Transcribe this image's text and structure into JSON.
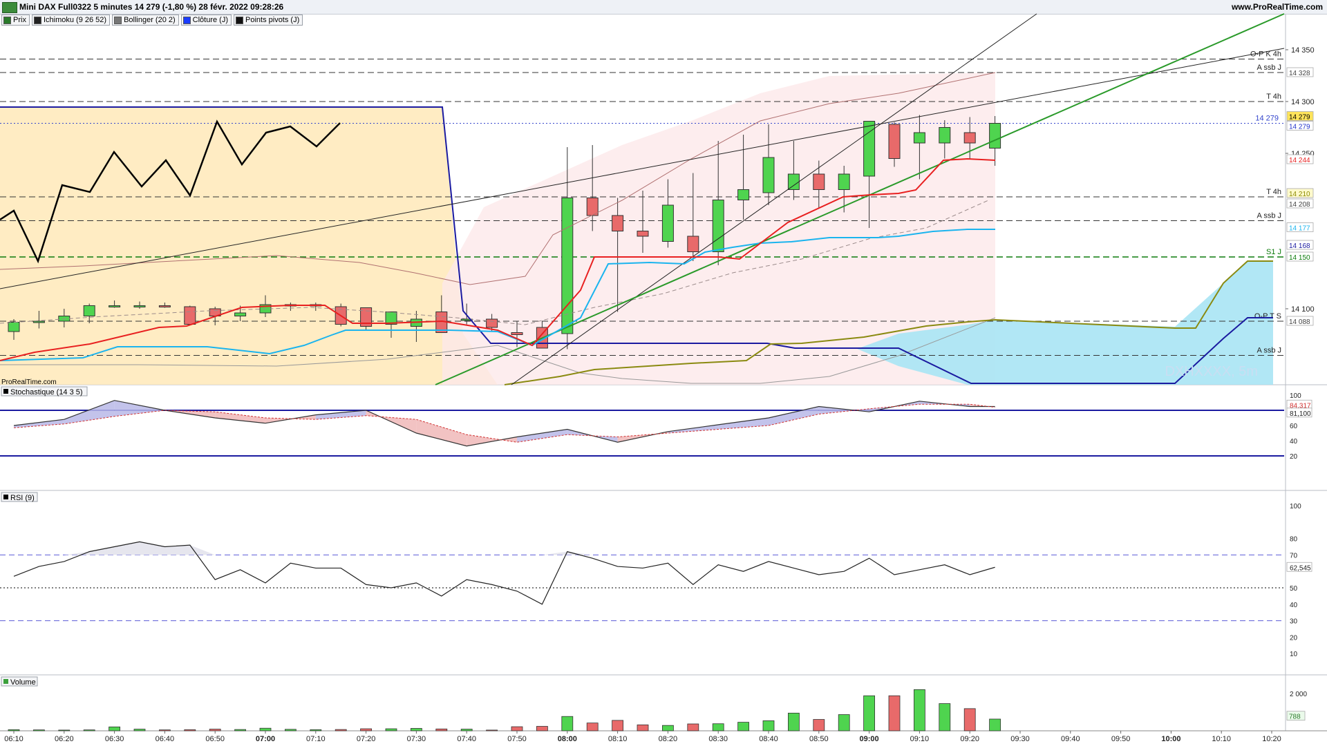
{
  "window": {
    "title": "Mini DAX Full0322 5 minutes 14 279 (-1,80 %) 28 févr. 2022 09:28:26",
    "site": "www.ProRealTime.com",
    "watermark_site": "ProRealTime.com",
    "watermark": "DXHXXXX, 5m"
  },
  "colors": {
    "bull": "#4fd44f",
    "bear": "#e86a6a",
    "tenkan": "#e82020",
    "kijun": "#1ab4ee",
    "chikou": "#000000",
    "cloud_bull": "#ffe9b8",
    "cloud_bear": "#a8e4f4",
    "bollinger": "#b07070",
    "blue_line": "#1a1aa0"
  },
  "legend": [
    {
      "label": "Prix",
      "swatch": "#2a7a2a"
    },
    {
      "label": "Ichimoku (9 26 52)",
      "swatch": "#222222"
    },
    {
      "label": "Bollinger (20 2)",
      "swatch": "#777777"
    },
    {
      "label": "Clôture (J)",
      "swatch": "#1a3cff"
    },
    {
      "label": "Points pivots (J)",
      "swatch": "#111111"
    }
  ],
  "chart_data": [
    {
      "type": "candlestick",
      "name": "Mini DAX Full0322 5 minutes",
      "x": [
        "06:10",
        "06:15",
        "06:20",
        "06:25",
        "06:30",
        "06:35",
        "06:40",
        "06:45",
        "06:50",
        "06:55",
        "07:00",
        "07:05",
        "07:10",
        "07:15",
        "07:20",
        "07:25",
        "07:30",
        "07:35",
        "07:40",
        "07:45",
        "07:50",
        "07:55",
        "08:00",
        "08:05",
        "08:10",
        "08:15",
        "08:20",
        "08:25",
        "08:30",
        "08:35",
        "08:40",
        "08:45",
        "08:50",
        "08:55",
        "09:00",
        "09:05",
        "09:10",
        "09:15",
        "09:20",
        "09:25"
      ],
      "open": [
        14078,
        14087,
        14088,
        14093,
        14103,
        14103,
        14103,
        14102,
        14100,
        14093,
        14096,
        14104,
        14104,
        14102,
        14101,
        14085,
        14083,
        14097,
        14090,
        14090,
        14077,
        14082,
        14076,
        14207,
        14190,
        14175,
        14165,
        14170,
        14155,
        14205,
        14212,
        14215,
        14230,
        14215,
        14228,
        14278,
        14260,
        14260,
        14270,
        14255
      ],
      "high": [
        14090,
        14098,
        14100,
        14105,
        14108,
        14107,
        14106,
        14103,
        14102,
        14103,
        14113,
        14106,
        14106,
        14105,
        14101,
        14096,
        14098,
        14113,
        14105,
        14095,
        14088,
        14088,
        14256,
        14258,
        14207,
        14214,
        14225,
        14231,
        14262,
        14268,
        14278,
        14262,
        14243,
        14238,
        14281,
        14280,
        14287,
        14282,
        14285,
        14286
      ],
      "low": [
        14070,
        14081,
        14082,
        14086,
        14101,
        14100,
        14101,
        14084,
        14084,
        14088,
        14092,
        14098,
        14098,
        14083,
        14079,
        14072,
        14068,
        14080,
        14085,
        14078,
        14063,
        14062,
        14061,
        14175,
        14097,
        14154,
        14159,
        14146,
        14142,
        14186,
        14200,
        14205,
        14197,
        14193,
        14178,
        14237,
        14225,
        14245,
        14245,
        14238
      ],
      "close": [
        14087,
        14088,
        14093,
        14103,
        14103,
        14103,
        14102,
        14085,
        14093,
        14096,
        14104,
        14104,
        14104,
        14085,
        14083,
        14097,
        14090,
        14077,
        14090,
        14082,
        14075,
        14062,
        14207,
        14190,
        14175,
        14170,
        14200,
        14155,
        14205,
        14215,
        14246,
        14230,
        14215,
        14230,
        14281,
        14245,
        14270,
        14275,
        14260,
        14279
      ]
    },
    {
      "type": "bar",
      "name": "Volume",
      "x": [
        "06:10",
        "06:15",
        "06:20",
        "06:25",
        "06:30",
        "06:35",
        "06:40",
        "06:45",
        "06:50",
        "06:55",
        "07:00",
        "07:05",
        "07:10",
        "07:15",
        "07:20",
        "07:25",
        "07:30",
        "07:35",
        "07:40",
        "07:45",
        "07:50",
        "07:55",
        "08:00",
        "08:05",
        "08:10",
        "08:15",
        "08:20",
        "08:25",
        "08:30",
        "08:35",
        "08:40",
        "08:45",
        "08:50",
        "08:55",
        "09:00",
        "09:05",
        "09:10",
        "09:15",
        "09:20",
        "09:25"
      ],
      "values": [
        60,
        50,
        40,
        50,
        210,
        90,
        50,
        60,
        90,
        70,
        140,
        80,
        60,
        70,
        110,
        110,
        130,
        100,
        90,
        40,
        220,
        240,
        770,
        420,
        560,
        320,
        290,
        370,
        380,
        460,
        540,
        950,
        610,
        870,
        1880,
        1880,
        2210,
        1460,
        1190,
        630
      ],
      "last_value_label": "788"
    },
    {
      "type": "line",
      "name": "Stochastique (14 3 5)",
      "x": [
        "06:10",
        "06:20",
        "06:30",
        "06:40",
        "06:50",
        "07:00",
        "07:10",
        "07:20",
        "07:30",
        "07:40",
        "07:50",
        "08:00",
        "08:10",
        "08:20",
        "08:30",
        "08:40",
        "08:50",
        "09:00",
        "09:10",
        "09:20",
        "09:25"
      ],
      "series": [
        {
          "values": [
            60,
            68,
            93,
            80,
            70,
            63,
            74,
            80,
            50,
            33,
            45,
            55,
            38,
            52,
            61,
            70,
            85,
            78,
            92,
            85,
            85
          ]
        },
        {
          "values": [
            57,
            62,
            72,
            80,
            78,
            70,
            68,
            73,
            68,
            48,
            38,
            48,
            45,
            50,
            55,
            60,
            75,
            82,
            88,
            88,
            84
          ]
        }
      ],
      "levels": [
        20,
        80
      ],
      "ticks": [
        "100",
        "84,317",
        "81,100",
        "60",
        "40",
        "20"
      ]
    },
    {
      "type": "line",
      "name": "RSI (9)",
      "x": [
        "06:10",
        "06:15",
        "06:20",
        "06:25",
        "06:30",
        "06:35",
        "06:40",
        "06:45",
        "06:50",
        "06:55",
        "07:00",
        "07:05",
        "07:10",
        "07:15",
        "07:20",
        "07:25",
        "07:30",
        "07:35",
        "07:40",
        "07:45",
        "07:50",
        "07:55",
        "08:00",
        "08:05",
        "08:10",
        "08:15",
        "08:20",
        "08:25",
        "08:30",
        "08:35",
        "08:40",
        "08:45",
        "08:50",
        "08:55",
        "09:00",
        "09:05",
        "09:10",
        "09:15",
        "09:20",
        "09:25"
      ],
      "values": [
        57,
        63,
        66,
        72,
        75,
        78,
        75,
        76,
        55,
        61,
        53,
        65,
        62,
        62,
        52,
        50,
        53,
        45,
        55,
        52,
        48,
        40,
        72,
        68,
        63,
        62,
        65,
        52,
        64,
        60,
        66,
        62,
        58,
        60,
        68,
        58,
        61,
        64,
        58,
        62.5
      ],
      "levels": [
        30,
        50,
        70
      ],
      "ticks": [
        "100",
        "80",
        "70",
        "62,545",
        "50",
        "40",
        "30",
        "20",
        "10"
      ]
    }
  ],
  "price_axis": {
    "ticks": [
      "14 350",
      "14 300",
      "14 250",
      "14 100"
    ],
    "markers": [
      {
        "label": "14 328",
        "bg": "#ffffff",
        "fg": "#444444"
      },
      {
        "label": "14 279",
        "bg": "#ffe45a",
        "fg": "#000000"
      },
      {
        "label": "14 279",
        "bg": "#ffffff",
        "fg": "#2233cc"
      },
      {
        "label": "14 244",
        "bg": "#ffffff",
        "fg": "#e82020"
      },
      {
        "label": "14 210",
        "bg": "#fffacc",
        "fg": "#8a8a00"
      },
      {
        "label": "14 208",
        "bg": "#ffffff",
        "fg": "#444444"
      },
      {
        "label": "14 177",
        "bg": "#ffffff",
        "fg": "#1ab4ee"
      },
      {
        "label": "14 168",
        "bg": "#ffffff",
        "fg": "#1a1aa0"
      },
      {
        "label": "14 150",
        "bg": "#ffffff",
        "fg": "#0a7a0a"
      },
      {
        "label": "14 088",
        "bg": "#ffffff",
        "fg": "#444444"
      }
    ],
    "last_price_tag": "14 279"
  },
  "pivot_lines": [
    {
      "label": "O-P K 4h",
      "price": 14341
    },
    {
      "label": "A ssb J",
      "price": 14328
    },
    {
      "label": "T 4h",
      "price": 14300
    },
    {
      "label": "T 4h",
      "price": 14208
    },
    {
      "label": "A ssb J",
      "price": 14185
    },
    {
      "label": "S1 J",
      "price": 14150
    },
    {
      "label": "O-P T S",
      "price": 14088
    },
    {
      "label": "A ssb J",
      "price": 14055
    }
  ],
  "time_axis": [
    "06:10",
    "06:20",
    "06:30",
    "06:40",
    "06:50",
    "07:00",
    "07:10",
    "07:20",
    "07:30",
    "07:40",
    "07:50",
    "08:00",
    "08:10",
    "08:20",
    "08:30",
    "08:40",
    "08:50",
    "09:00",
    "09:10",
    "09:20",
    "09:30",
    "09:40",
    "09:50",
    "10:00",
    "10:10",
    "10:20"
  ],
  "time_axis_bold": [
    "07:00",
    "08:00",
    "09:00",
    "10:00"
  ],
  "panels": {
    "stoch_label": "Stochastique (14 3 5)",
    "rsi_label": "RSI (9)",
    "volume_label": "Volume",
    "volume_tick": "2 000"
  }
}
